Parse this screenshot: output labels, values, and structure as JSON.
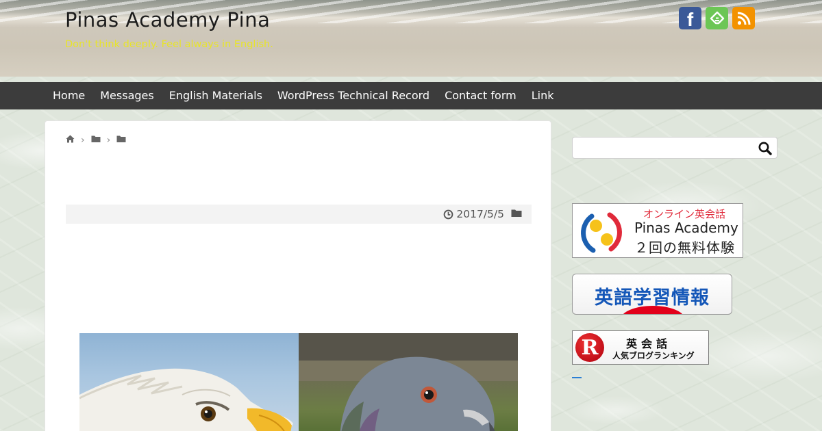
{
  "site": {
    "title": "Pinas Academy Pina",
    "tagline": "Don't think deeply. Feel always in English."
  },
  "social": [
    {
      "name": "facebook-icon",
      "label": "f",
      "color": "#3b5998"
    },
    {
      "name": "feedly-icon",
      "label": "",
      "color": "#6cc655"
    },
    {
      "name": "rss-icon",
      "label": "",
      "color": "#f39200"
    }
  ],
  "nav": {
    "items": [
      "Home",
      "Messages",
      "English Materials",
      "WordPress Technical Record",
      "Contact form",
      "Link"
    ]
  },
  "breadcrumb": {
    "icons": [
      "home-icon",
      "folder-icon",
      "folder-icon"
    ]
  },
  "post": {
    "date": "2017/5/5"
  },
  "sidebar": {
    "search": {
      "placeholder": "",
      "value": ""
    },
    "banner_pinas": {
      "line1": "オンライン英会話",
      "line2": "Pinas Academy",
      "line3": "２回の無料体験"
    },
    "banner_info": {
      "text": "英語学習情報"
    },
    "banner_rank": {
      "logo": "R",
      "line1": "英会話",
      "line2": "人気ブログランキング"
    }
  },
  "colors": {
    "nav_bg": "#3c3c3c",
    "tagline": "#e8e42a",
    "accent_blue": "#1457b8",
    "accent_red": "#e02a3a"
  }
}
